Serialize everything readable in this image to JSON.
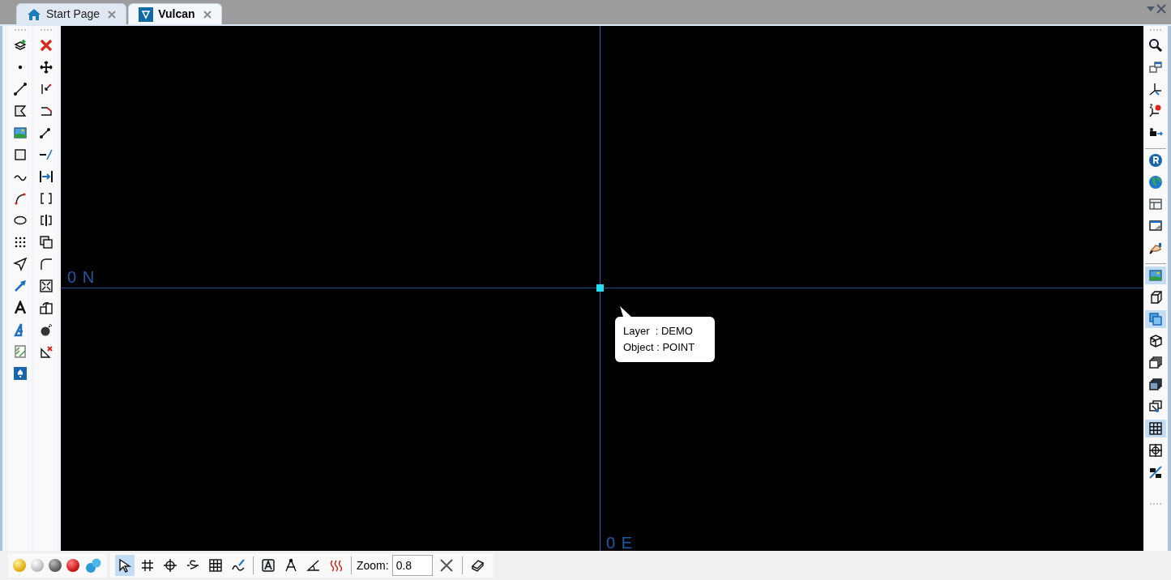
{
  "tabs": [
    {
      "label": "Start Page",
      "selected": false
    },
    {
      "label": "Vulcan",
      "selected": true
    }
  ],
  "right_toolbar": [
    {
      "on": false
    },
    {
      "on": false
    },
    {
      "on": false
    },
    {
      "on": false
    },
    {
      "on": false
    },
    {
      "on": false
    },
    {
      "on": false
    },
    {
      "on": false
    },
    {
      "on": false
    },
    {
      "on": false
    },
    {
      "on": true
    },
    {
      "on": false
    },
    {
      "on": true
    },
    {
      "on": false
    },
    {
      "on": false
    },
    {
      "on": false
    },
    {
      "on": false
    },
    {
      "on": true
    },
    {
      "on": false
    },
    {
      "on": false
    }
  ],
  "canvas": {
    "north_label": "0 N",
    "east_label": "0 E",
    "tooltip": [
      "Layer  : DEMO",
      "Object : POINT"
    ]
  },
  "snap_tools": [
    {
      "on": true
    },
    {
      "on": false
    },
    {
      "on": false
    },
    {
      "on": false
    },
    {
      "on": false
    },
    {
      "on": false
    }
  ],
  "zoom": {
    "label": "Zoom:",
    "value": "0.8"
  }
}
